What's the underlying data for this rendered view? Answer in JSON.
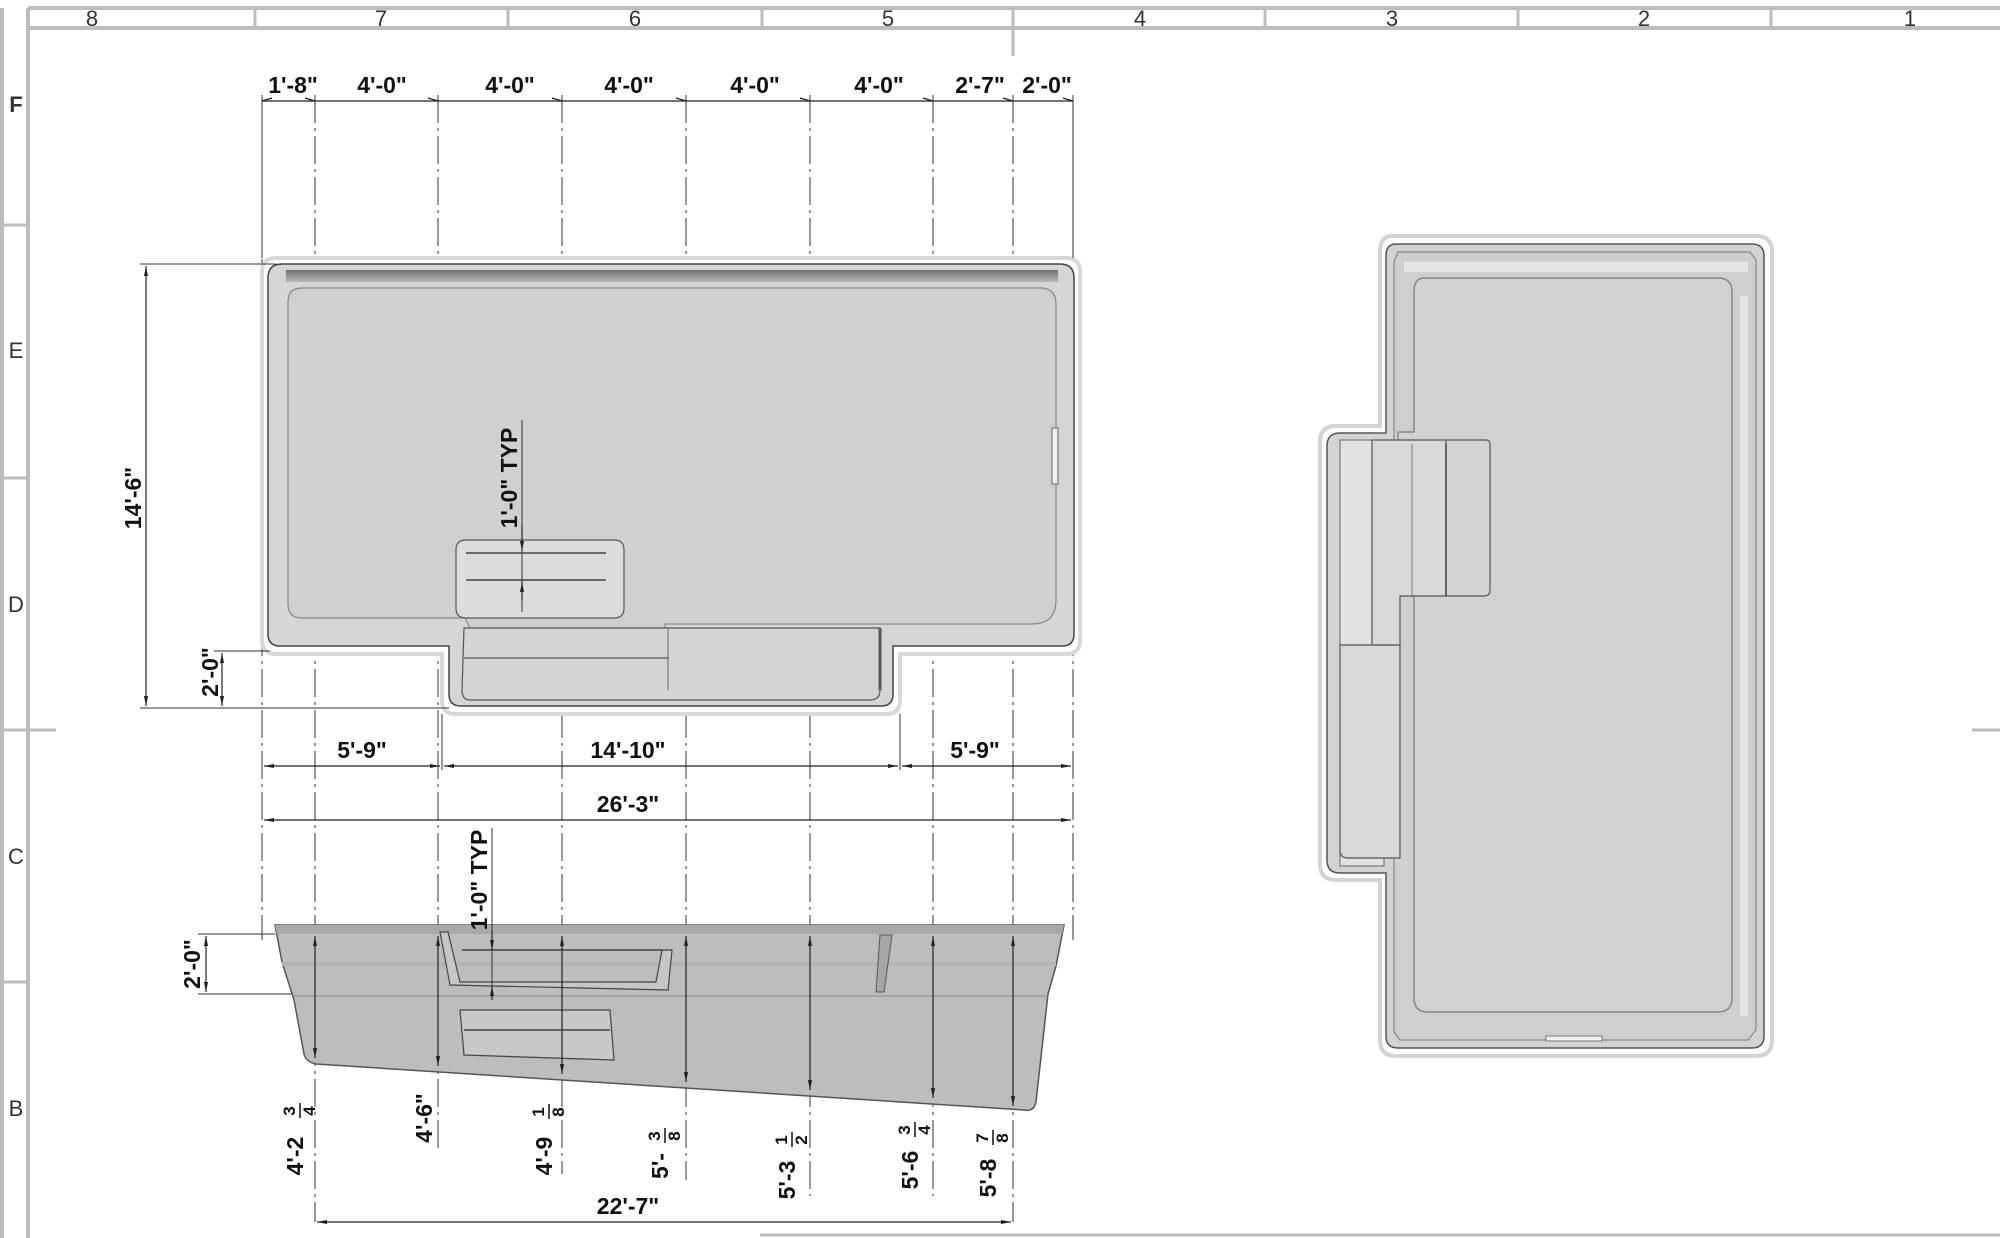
{
  "drawing": {
    "zones_top": [
      "8",
      "7",
      "6",
      "5",
      "4",
      "3",
      "2",
      "1"
    ],
    "zones_left": [
      "F",
      "E",
      "D",
      "C",
      "B"
    ],
    "plan": {
      "top_dims": [
        "1'-8\"",
        "4'-0\"",
        "4'-0\"",
        "4'-0\"",
        "4'-0\"",
        "4'-0\"",
        "2'-7\"",
        "2'-0\""
      ],
      "overall_width": "14'-6\"",
      "step_depth": "2'-0\"",
      "step_height_note": "1'-0\" TYP",
      "bottom_dims": [
        "5'-9\"",
        "14'-10\"",
        "5'-9\""
      ],
      "overall_length": "26'-3\""
    },
    "section": {
      "step_height_note": "1'-0\" TYP",
      "top_depth": "2'-0\"",
      "depth_labels": [
        {
          "whole": "4'-2",
          "num": "3",
          "den": "4"
        },
        {
          "whole": "4'-6\"",
          "num": "",
          "den": ""
        },
        {
          "whole": "4'-9",
          "num": "1",
          "den": "8"
        },
        {
          "whole": "5'-",
          "num": "3",
          "den": "8"
        },
        {
          "whole": "5'-3",
          "num": "1",
          "den": "2"
        },
        {
          "whole": "5'-6",
          "num": "3",
          "den": "4"
        },
        {
          "whole": "5'-8",
          "num": "7",
          "den": "8"
        }
      ],
      "floor_length": "22'-7\""
    }
  }
}
